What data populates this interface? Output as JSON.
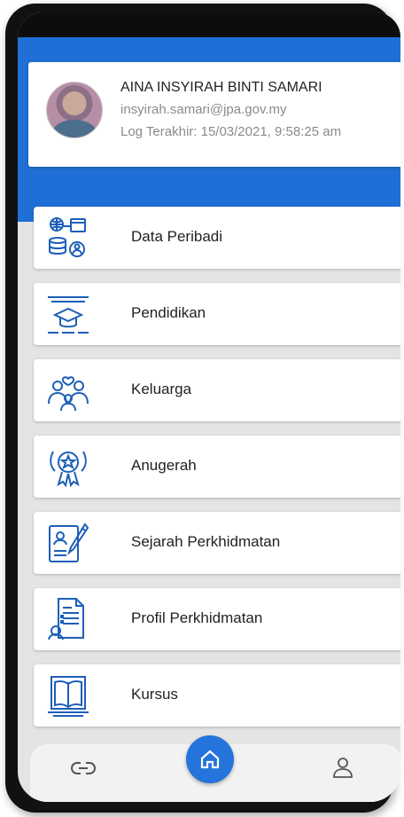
{
  "profile": {
    "name": "AINA INSYIRAH BINTI SAMARI",
    "email": "insyirah.samari@jpa.gov.my",
    "last_login": "Log Terakhir: 15/03/2021, 9:58:25 am"
  },
  "menu": [
    {
      "label": "Data Peribadi",
      "icon": "database-person-icon"
    },
    {
      "label": "Pendidikan",
      "icon": "graduation-cap-icon"
    },
    {
      "label": "Keluarga",
      "icon": "family-icon"
    },
    {
      "label": "Anugerah",
      "icon": "award-badge-icon"
    },
    {
      "label": "Sejarah Perkhidmatan",
      "icon": "service-history-icon"
    },
    {
      "label": "Profil Perkhidmatan",
      "icon": "service-profile-icon"
    },
    {
      "label": "Kursus",
      "icon": "book-icon"
    }
  ],
  "nav": {
    "left": "link-icon",
    "center": "home-icon",
    "right": "user-icon"
  },
  "colors": {
    "primary": "#1f6fd6",
    "icon_blue": "#1d5fb8",
    "background": "#e4e4e4"
  }
}
